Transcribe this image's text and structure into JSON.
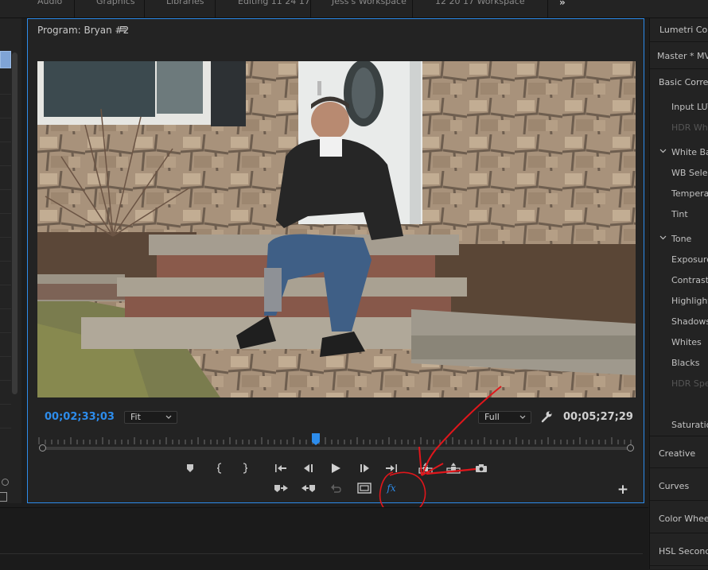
{
  "workspace": {
    "tabs": [
      "Audio",
      "Graphics",
      "Libraries",
      "Editing 11 24 17",
      "Jess's Workspace",
      "12 20 17 Workspace"
    ],
    "more": "»"
  },
  "monitor": {
    "title": "Program: Bryan #2",
    "menu_icon": "hamburger-icon",
    "timecode_current": "00;02;33;03",
    "zoom_select": "Fit",
    "quality_select": "Full",
    "timecode_duration": "00;05;27;29",
    "fx_label": "fx",
    "add_label": "+",
    "playhead_fraction": 0.465
  },
  "lumetri": {
    "title": "Lumetri Colo",
    "master": "Master * MV",
    "basic": "Basic Correct",
    "input_lut": "Input LUT",
    "hdr_white": "HDR Whi",
    "white_balance": "White Ba",
    "wb_selector": "WB Selec",
    "temperature": "Temperat",
    "tint": "Tint",
    "tone": "Tone",
    "exposure": "Exposure",
    "contrast": "Contrast",
    "highlights": "Highlight",
    "shadows": "Shadows",
    "whites": "Whites",
    "blacks": "Blacks",
    "hdr_specular": "HDR Spec",
    "saturation": "Saturation",
    "creative": "Creative",
    "curves": "Curves",
    "color_wheels": "Color Wheels",
    "hsl": "HSL Seconda"
  },
  "colors": {
    "accent": "#2d8ceb",
    "annotation": "#e0161b"
  }
}
